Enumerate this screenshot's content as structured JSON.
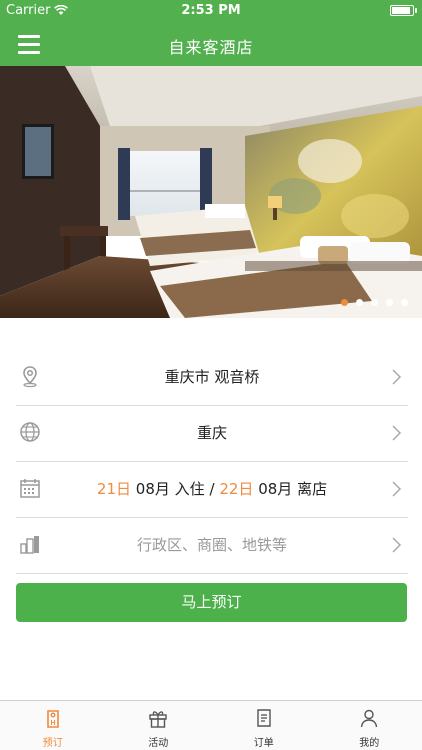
{
  "status_bar": {
    "carrier": "Carrier",
    "time": "2:53 PM"
  },
  "nav": {
    "title": "自来客酒店"
  },
  "banner": {
    "slide_count": 5,
    "active_index": 0
  },
  "form": {
    "location": "重庆市 观音桥",
    "city": "重庆",
    "dates": {
      "checkin_day": "21日",
      "checkin_month": "08月",
      "checkin_label": "入住",
      "separator": "/",
      "checkout_day": "22日",
      "checkout_month": "08月",
      "checkout_label": "离店"
    },
    "district_placeholder": "行政区、商圈、地铁等"
  },
  "book_button": {
    "label": "马上预订"
  },
  "tabs": [
    {
      "label": "预订",
      "icon": "hotel-door-icon",
      "active": true
    },
    {
      "label": "活动",
      "icon": "gift-icon",
      "active": false
    },
    {
      "label": "订单",
      "icon": "order-list-icon",
      "active": false
    },
    {
      "label": "我的",
      "icon": "user-icon",
      "active": false
    }
  ],
  "colors": {
    "brand_green": "#52b04f",
    "accent_orange": "#f08a3c"
  }
}
